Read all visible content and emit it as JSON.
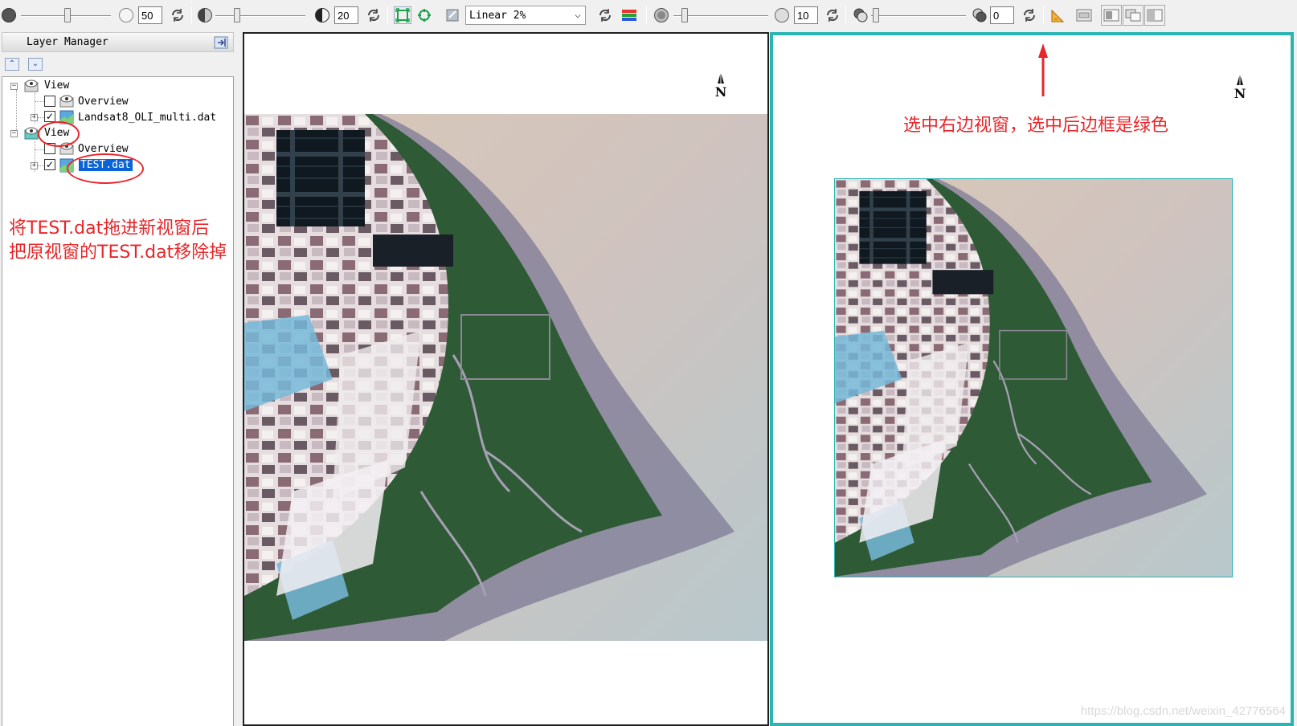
{
  "toolbar": {
    "brightness_value": "50",
    "contrast_value": "20",
    "stretch_mode": "Linear 2%",
    "sharpen_value": "10",
    "transparency_value": "0"
  },
  "layer_manager": {
    "title": "Layer Manager",
    "tree": [
      {
        "label": "View",
        "children": [
          {
            "label": "Overview",
            "checked": false
          },
          {
            "label": "Landsat8_OLI_multi.dat",
            "checked": true
          }
        ]
      },
      {
        "label": "View",
        "children": [
          {
            "label": "Overview",
            "checked": false
          },
          {
            "label": "TEST.dat",
            "checked": true,
            "selected": true
          }
        ]
      }
    ],
    "note_line1": "将TEST.dat拖进新视窗后",
    "note_line2": "把原视窗的TEST.dat移除掉"
  },
  "views": {
    "north_label": "N",
    "right_note": "选中右边视窗，选中后边框是绿色",
    "watermark": "https://blog.csdn.net/weixin_42776564"
  },
  "colors": {
    "annotation": "#e8262a",
    "active_view_border": "#2ab5b3",
    "selection": "#0a64d8"
  }
}
